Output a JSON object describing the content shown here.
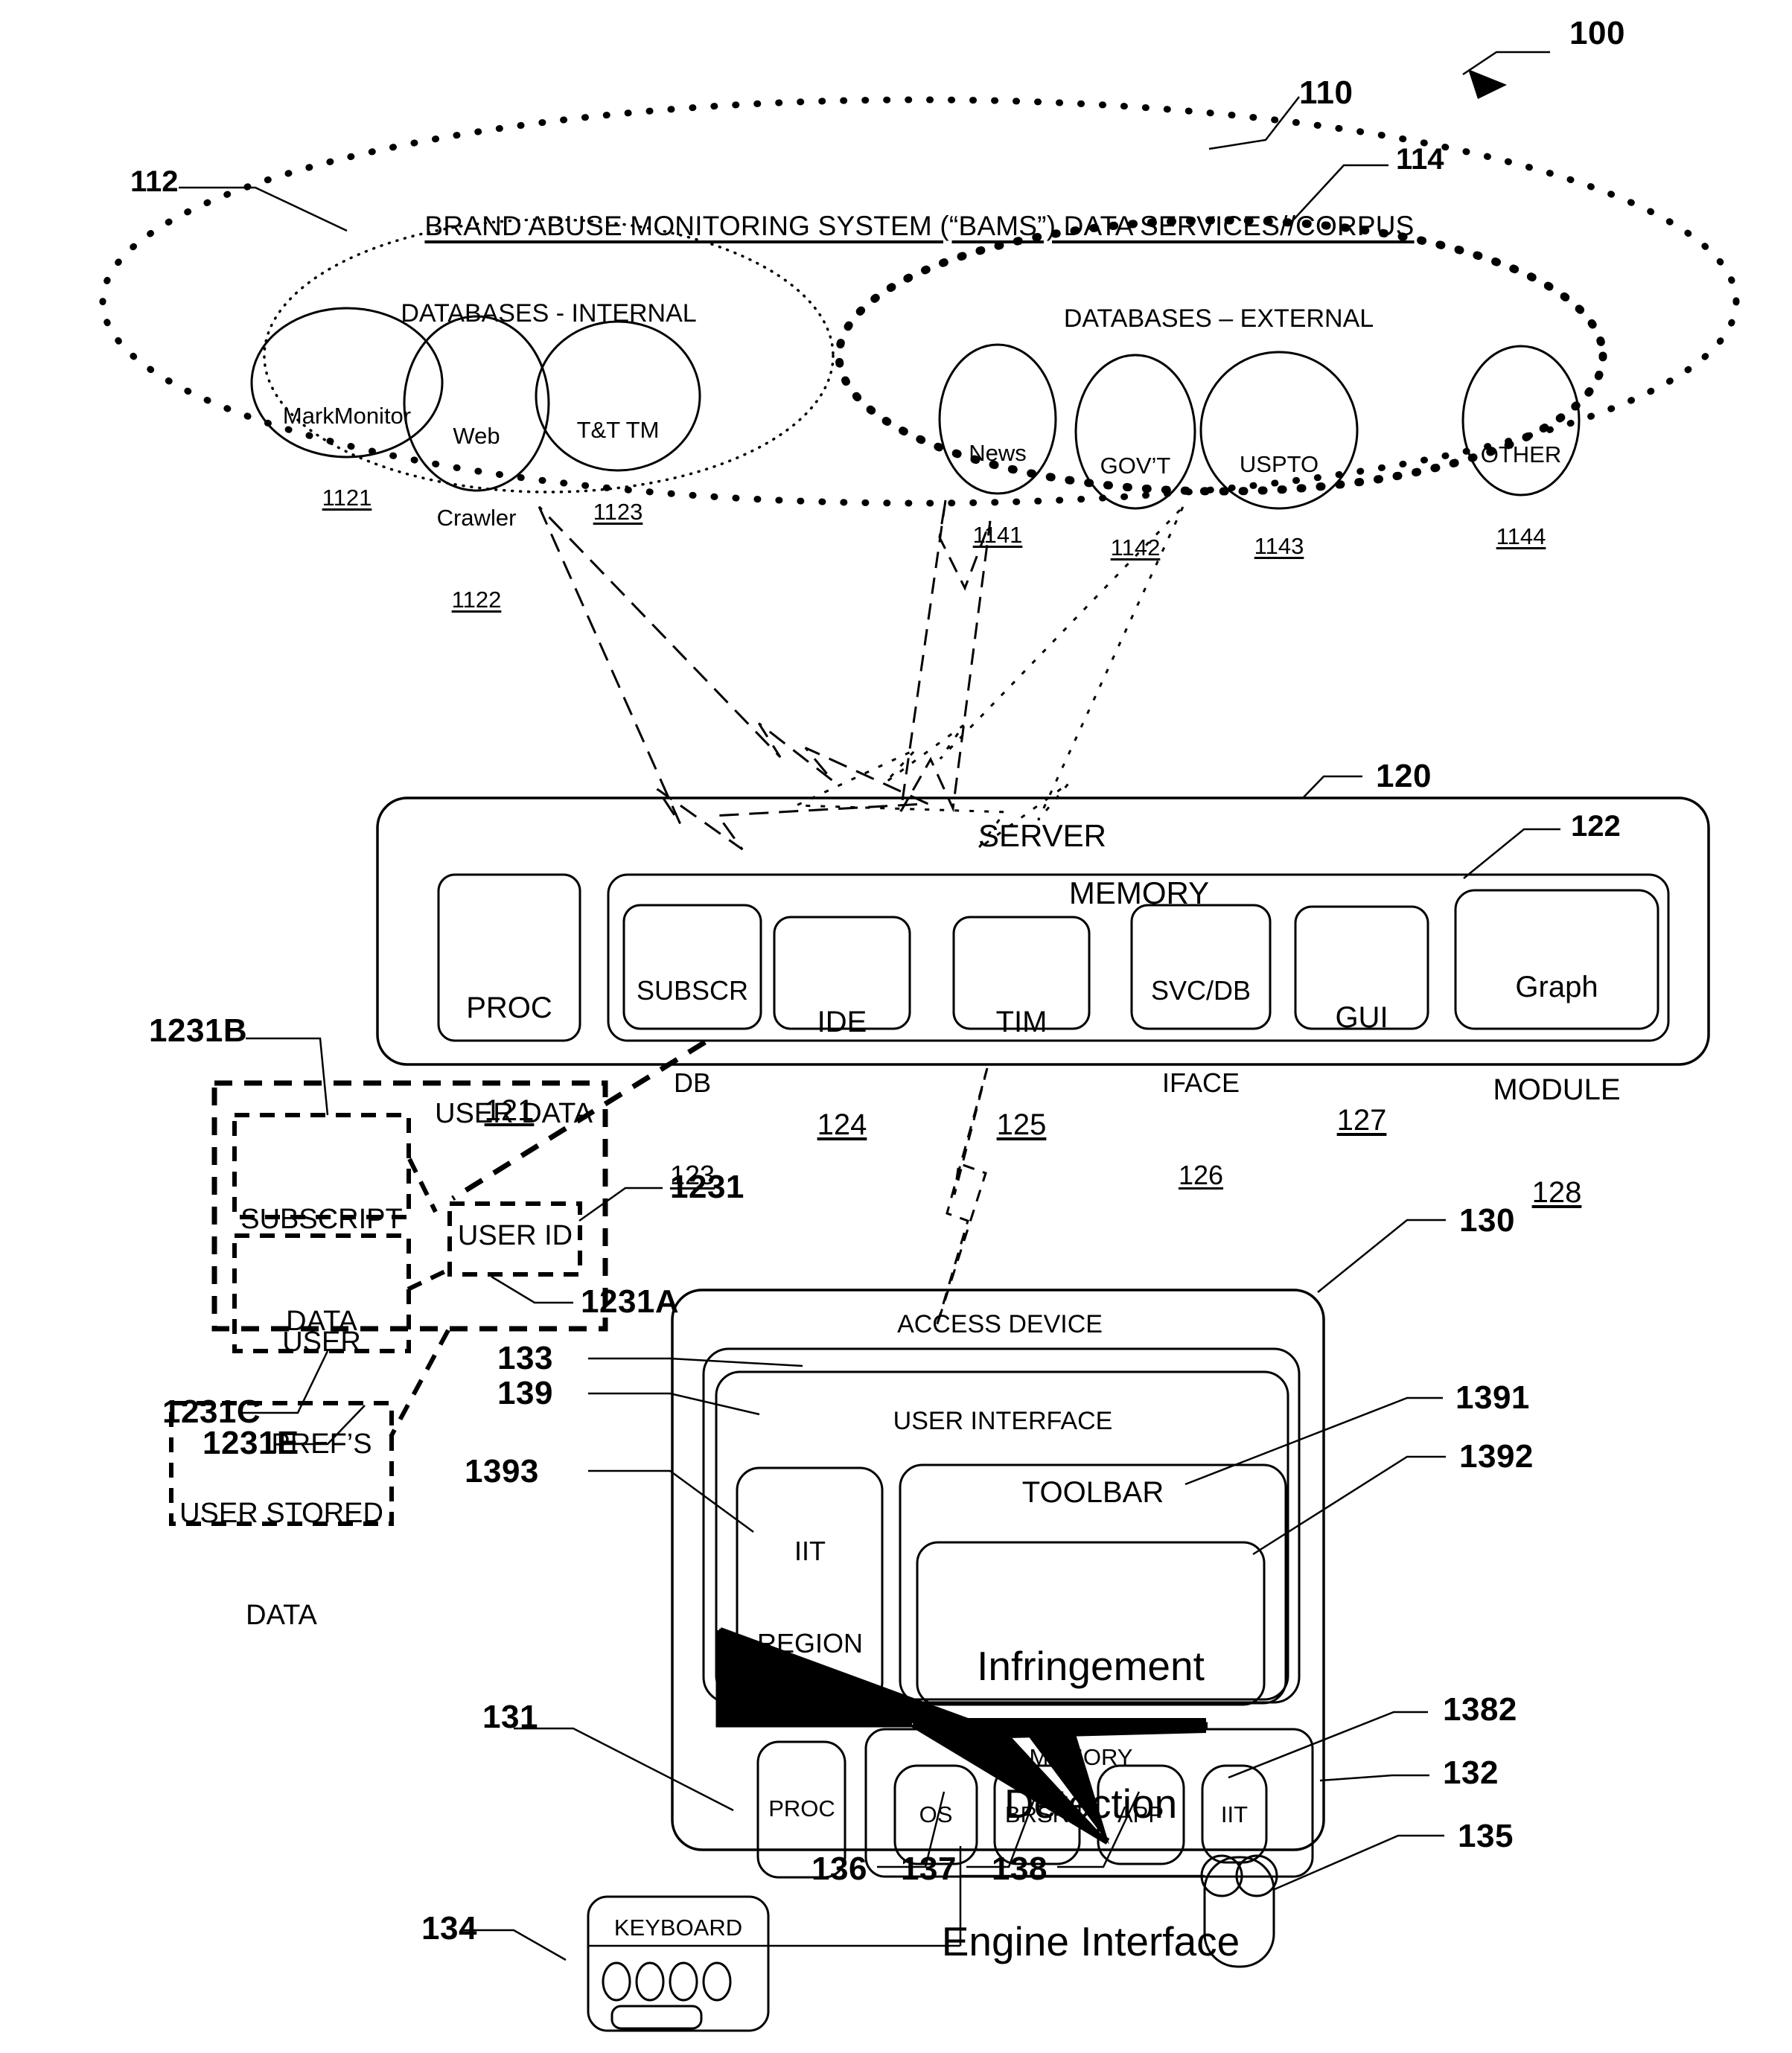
{
  "figure": {
    "system_ref": "100"
  },
  "corpus": {
    "ref": "110",
    "title": "BRAND ABUSE MONITORING SYSTEM (“BAMS”) DATA SERVICES//CORPUS",
    "internal": {
      "ref": "112",
      "label": "DATABASES - INTERNAL",
      "nodes": [
        {
          "name": "MarkMonitor",
          "num": "1121"
        },
        {
          "name": "Web\nCrawler",
          "num": "1122"
        },
        {
          "name": "T&T TM",
          "num": "1123"
        }
      ]
    },
    "external": {
      "ref": "114",
      "label": "DATABASES – EXTERNAL",
      "nodes": [
        {
          "name": "News",
          "num": "1141"
        },
        {
          "name": "GOV’T",
          "num": "1142"
        },
        {
          "name": "USPTO",
          "num": "1143"
        },
        {
          "name": "OTHER",
          "num": "1144"
        }
      ]
    }
  },
  "server": {
    "ref": "120",
    "title": "SERVER",
    "proc": {
      "label": "PROC",
      "num": "121"
    },
    "memory": {
      "ref": "122",
      "label": "MEMORY",
      "modules": [
        {
          "line1": "SUBSCR",
          "line2": "DB",
          "num": "123"
        },
        {
          "line1": "IDE",
          "line2": "",
          "num": "124"
        },
        {
          "line1": "TIM",
          "line2": "",
          "num": "125"
        },
        {
          "line1": "SVC/DB",
          "line2": "IFACE",
          "num": "126"
        },
        {
          "line1": "GUI",
          "line2": "",
          "num": "127"
        },
        {
          "line1": "Graph",
          "line2": "MODULE",
          "num": "128"
        }
      ]
    }
  },
  "user_data": {
    "ref": "1231",
    "label": "USER DATA",
    "subscript_data": {
      "ref": "1231B",
      "line1": "SUBSCRIPT",
      "line2": "DATA"
    },
    "user_prefs": {
      "ref": "1231C",
      "line1": "USER",
      "line2": "PREF’S"
    },
    "user_id": {
      "ref": "1231A",
      "label": "USER ID"
    },
    "user_stored_data": {
      "ref": "1231E",
      "line1": "USER STORED",
      "line2": "DATA"
    }
  },
  "access_device": {
    "ref": "130",
    "title": "ACCESS DEVICE",
    "screen_ref": "133",
    "user_interface": {
      "ref": "139",
      "label": "USER INTERFACE",
      "iit_region": {
        "ref": "1393",
        "line1": "IIT",
        "line2": "REGION"
      },
      "toolbar": {
        "ref": "1391",
        "label": "TOOLBAR"
      },
      "ide_interface": {
        "ref": "1392",
        "line1": "Infringement",
        "line2": "Detection",
        "line3": "Engine Interface"
      }
    },
    "proc": {
      "ref": "131",
      "label": "PROC"
    },
    "memory": {
      "ref": "132",
      "label": "MEMORY",
      "modules": [
        {
          "label": "OS",
          "ref": "136"
        },
        {
          "label": "BRSR",
          "ref": "137"
        },
        {
          "label": "APP",
          "ref": "138"
        },
        {
          "label": "IIT",
          "ref": "1382"
        }
      ]
    },
    "keyboard": {
      "ref": "134",
      "label": "KEYBOARD"
    },
    "mouse": {
      "ref": "135"
    }
  }
}
